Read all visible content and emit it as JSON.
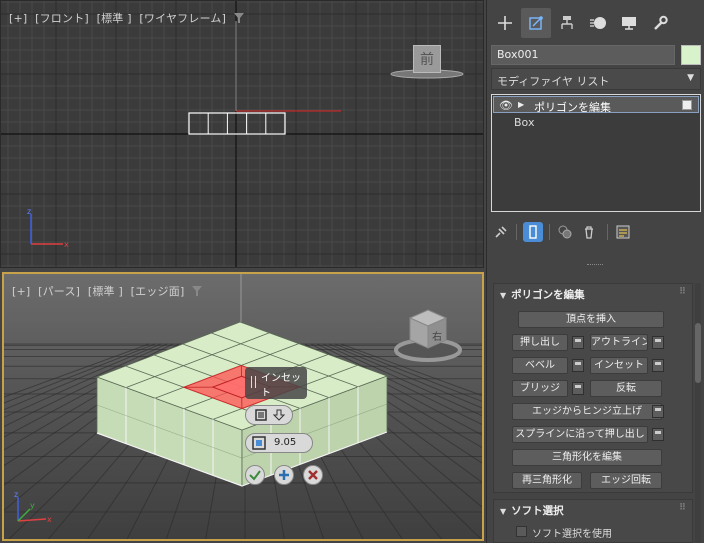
{
  "viewport_top": {
    "label": [
      "[+]",
      "[フロント]",
      "[標準 ]",
      "[ワイヤフレーム]"
    ],
    "viewcube_label": "前"
  },
  "viewport_bottom": {
    "label": [
      "[+]",
      "[パース]",
      "[標準 ]",
      "[エッジ面]"
    ],
    "viewcube_label": "右",
    "caddy": {
      "title": "インセット",
      "amount_value": "9.05",
      "ok_icon": "check-icon",
      "apply_icon": "plus-icon",
      "cancel_icon": "cancel-icon"
    }
  },
  "panel": {
    "tabs": [
      "create-icon",
      "modify-icon",
      "hierarchy-icon",
      "motion-icon",
      "display-icon",
      "utilities-icon"
    ],
    "active_tab": 1,
    "object_name": "Box001",
    "object_color": "#d8f2cc",
    "modifier_list": "モディファイヤ リスト",
    "stack": {
      "items": [
        "ポリゴンを編集",
        "Box"
      ]
    },
    "edit_poly": {
      "title": "ポリゴンを編集",
      "insert_vertex": "頂点を挿入",
      "extrude": "押し出し",
      "outline": "アウトライン",
      "bevel": "ベベル",
      "inset": "インセット",
      "bridge": "ブリッジ",
      "flip": "反転",
      "hinge": "エッジからヒンジ立上げ",
      "extrude_spline": "スプラインに沿って押し出し",
      "edit_tri": "三角形化を編集",
      "retriangulate": "再三角形化",
      "turn": "エッジ回転"
    },
    "soft_selection": {
      "title": "ソフト選択",
      "use_soft": "ソフト選択を使用"
    }
  },
  "colors": {
    "accent": "#4a8dd6",
    "viewport_active_border": "#c8a24a",
    "selection": "#ff6f6f",
    "box_face": "#d8ecc8"
  }
}
